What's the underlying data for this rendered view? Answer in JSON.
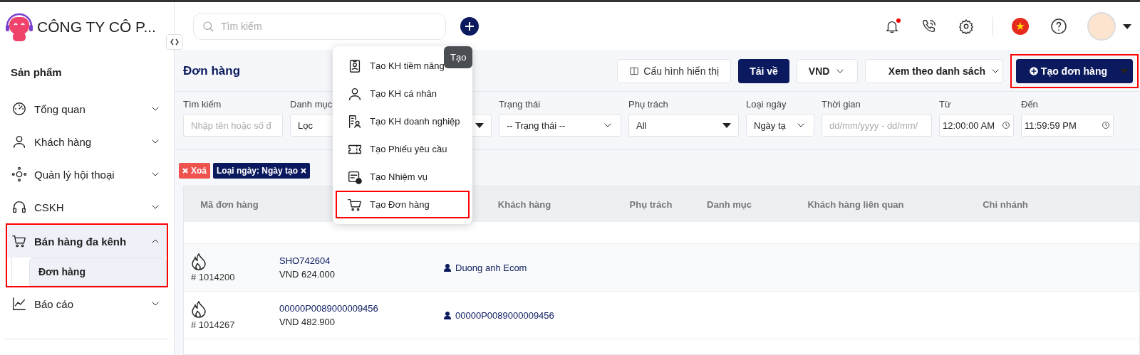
{
  "sidebar": {
    "company": "CÔNG TY CÔ P...",
    "section": "Sản phẩm",
    "items": [
      {
        "label": "Tổng quan",
        "expanded": false,
        "highlighted": false
      },
      {
        "label": "Khách hàng",
        "expanded": false,
        "highlighted": false
      },
      {
        "label": "Quản lý hội thoại",
        "expanded": false,
        "highlighted": false
      },
      {
        "label": "CSKH",
        "expanded": false,
        "highlighted": false
      },
      {
        "label": "Bán hàng đa kênh",
        "expanded": true,
        "highlighted": true,
        "children": [
          {
            "label": "Đơn hàng",
            "selected": true
          }
        ]
      },
      {
        "label": "Báo cáo",
        "expanded": false,
        "highlighted": false
      }
    ]
  },
  "header": {
    "search": {
      "placeholder": "Tìm kiếm"
    },
    "create_tooltip": "Tạo",
    "notification_unread": true
  },
  "create_menu": {
    "items": [
      {
        "label": "Tạo KH tiềm năng",
        "highlighted": false
      },
      {
        "label": "Tạo KH cá nhân",
        "highlighted": false
      },
      {
        "label": "Tạo KH doanh nghiệp",
        "highlighted": false
      },
      {
        "label": "Tạo Phiếu yêu cầu",
        "highlighted": false
      },
      {
        "label": "Tạo Nhiệm vụ",
        "highlighted": false
      },
      {
        "label": "Tạo Đơn hàng",
        "highlighted": true
      }
    ]
  },
  "page": {
    "title": "Đơn hàng",
    "display_config": "Cấu hình hiển thị",
    "download": "Tải về",
    "currency": "VND",
    "view": "Xem theo danh sách",
    "create": {
      "label": "Tạo đơn hàng",
      "highlighted": true
    }
  },
  "filters": [
    {
      "kind": "input",
      "label": "Tìm kiếm",
      "placeholder": "Nhập tên hoặc số đ"
    },
    {
      "kind": "dropdown",
      "label": "Danh mục",
      "value": "Lọc"
    },
    {
      "kind": "select",
      "label": "Trạng thái",
      "value": "-- Trạng thái --"
    },
    {
      "kind": "dropdown",
      "label": "Phụ trách",
      "value": "All"
    },
    {
      "kind": "select",
      "label": "Loại ngày",
      "value": "Ngày tạ"
    },
    {
      "kind": "input",
      "label": "Thời gian",
      "placeholder": "dd/mm/yyyy - dd/mm/"
    },
    {
      "kind": "time",
      "label": "Từ",
      "value": "12:00:00 AM"
    },
    {
      "kind": "time",
      "label": "Đến",
      "value": "11:59:59 PM"
    }
  ],
  "chips": [
    {
      "kind": "clear",
      "label": "Xoá"
    },
    {
      "kind": "filter",
      "label": "Loại ngày: Ngày tạo"
    }
  ],
  "table": {
    "columns": [
      "Mã đơn hàng",
      "Khách hàng",
      "Phụ trách",
      "Danh mục",
      "Khách hàng liên quan",
      "Chi nhánh"
    ],
    "rows": [
      {
        "number": "# 1014200",
        "code": "SHO742604",
        "amount": "VND 624.000",
        "customer": "Duong anh Ecom",
        "hot": true
      },
      {
        "number": "# 1014267",
        "code": "00000P0089000009456",
        "amount": "VND 482.900",
        "customer": "00000P0089000009456",
        "hot": true
      }
    ]
  }
}
